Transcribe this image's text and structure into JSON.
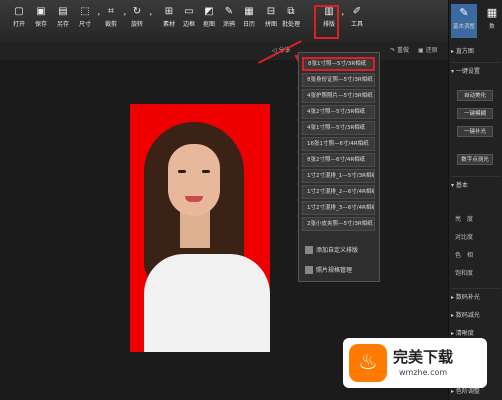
{
  "toolbar": {
    "items": [
      {
        "label": "打开",
        "icon": "open-icon",
        "glyph": "▢"
      },
      {
        "label": "保存",
        "icon": "save-icon",
        "glyph": "▣"
      },
      {
        "label": "另存",
        "icon": "save-as-icon",
        "glyph": "▤"
      },
      {
        "label": "尺寸",
        "icon": "resize-icon",
        "glyph": "⬚"
      },
      {
        "label": "裁剪",
        "icon": "crop-icon",
        "glyph": "⌗"
      },
      {
        "label": "旋转",
        "icon": "rotate-icon",
        "glyph": "↻"
      },
      {
        "label": "素材",
        "icon": "material-icon",
        "glyph": "⊞"
      },
      {
        "label": "边框",
        "icon": "border-icon",
        "glyph": "▭"
      },
      {
        "label": "抠图",
        "icon": "cutout-icon",
        "glyph": "◩"
      },
      {
        "label": "涂鸦",
        "icon": "brush-icon",
        "glyph": "✎"
      },
      {
        "label": "日历",
        "icon": "calendar-icon",
        "glyph": "▦"
      },
      {
        "label": "拼图",
        "icon": "collage-icon",
        "glyph": "⊟"
      },
      {
        "label": "批处理",
        "icon": "batch-icon",
        "glyph": "⧉"
      },
      {
        "label": "排版",
        "icon": "layout-icon",
        "glyph": "▥"
      },
      {
        "label": "工具",
        "icon": "tools-icon",
        "glyph": "✐"
      }
    ]
  },
  "secondary": {
    "share": "分享",
    "redo": "重做",
    "restore": "还原"
  },
  "dropdown": {
    "items": [
      "8张1寸照—5寸/3R相纸",
      "8张身份证照—5寸/3R相纸",
      "4张护照照片—5寸/3R相纸",
      "4张2寸照—5寸/3R相纸",
      "4张1寸照—5寸/3R相纸",
      "16张1寸照—6寸/4R相纸",
      "8张2寸照—6寸/4R相纸",
      "1寸2寸混排_1—5寸/3R相纸",
      "1寸2寸混排_2—6寸/4R相纸",
      "1寸2寸混排_3—6寸/4R相纸",
      "2张小皮夹照—5寸/3R相纸"
    ],
    "custom": "添加自定义排版",
    "manage": "照片规格管理"
  },
  "panel": {
    "tab_basic": "基本调整",
    "tab_second": "数",
    "histogram": "直方图",
    "one_click": "一键设置",
    "btn_auto": "自动美化",
    "btn_blur": "一键模糊",
    "btn_fill": "一键补光",
    "btn_digital": "数字点测光",
    "basic": "基本",
    "brightness": "亮　度",
    "contrast": "对比度",
    "hue": "色　相",
    "saturation": "饱和度",
    "digital_add": "数码补光",
    "digital_reduce": "数码减光",
    "clarity": "清晰度",
    "grayscale": "色阶调整"
  },
  "watermark": {
    "title": "完美下载",
    "site": "wmzhe.com"
  },
  "colors": {
    "accent": "#e02020",
    "photo_bg": "#ee0000",
    "active_tab": "#3a6aa0"
  }
}
